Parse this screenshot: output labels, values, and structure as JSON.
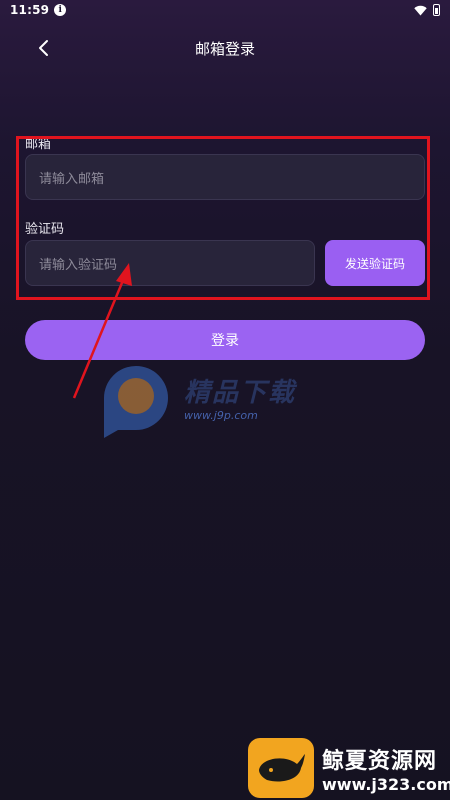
{
  "status_bar": {
    "time": "11:59",
    "info_glyph": "i"
  },
  "header": {
    "title": "邮箱登录",
    "back_icon": "chevron-left-icon"
  },
  "form": {
    "email": {
      "label": "邮箱",
      "placeholder": "请输入邮箱"
    },
    "code": {
      "label": "验证码",
      "placeholder": "请输入验证码"
    },
    "send_code_label": "发送验证码",
    "login_label": "登录"
  },
  "colors": {
    "accent": "#9b63f2",
    "highlight": "#e0141e",
    "background": "#181326"
  },
  "watermarks": {
    "center_name": "精品下载",
    "center_url": "www.j9p.com",
    "brand_name": "鲸夏资源网",
    "brand_url": "www.j323.com"
  }
}
